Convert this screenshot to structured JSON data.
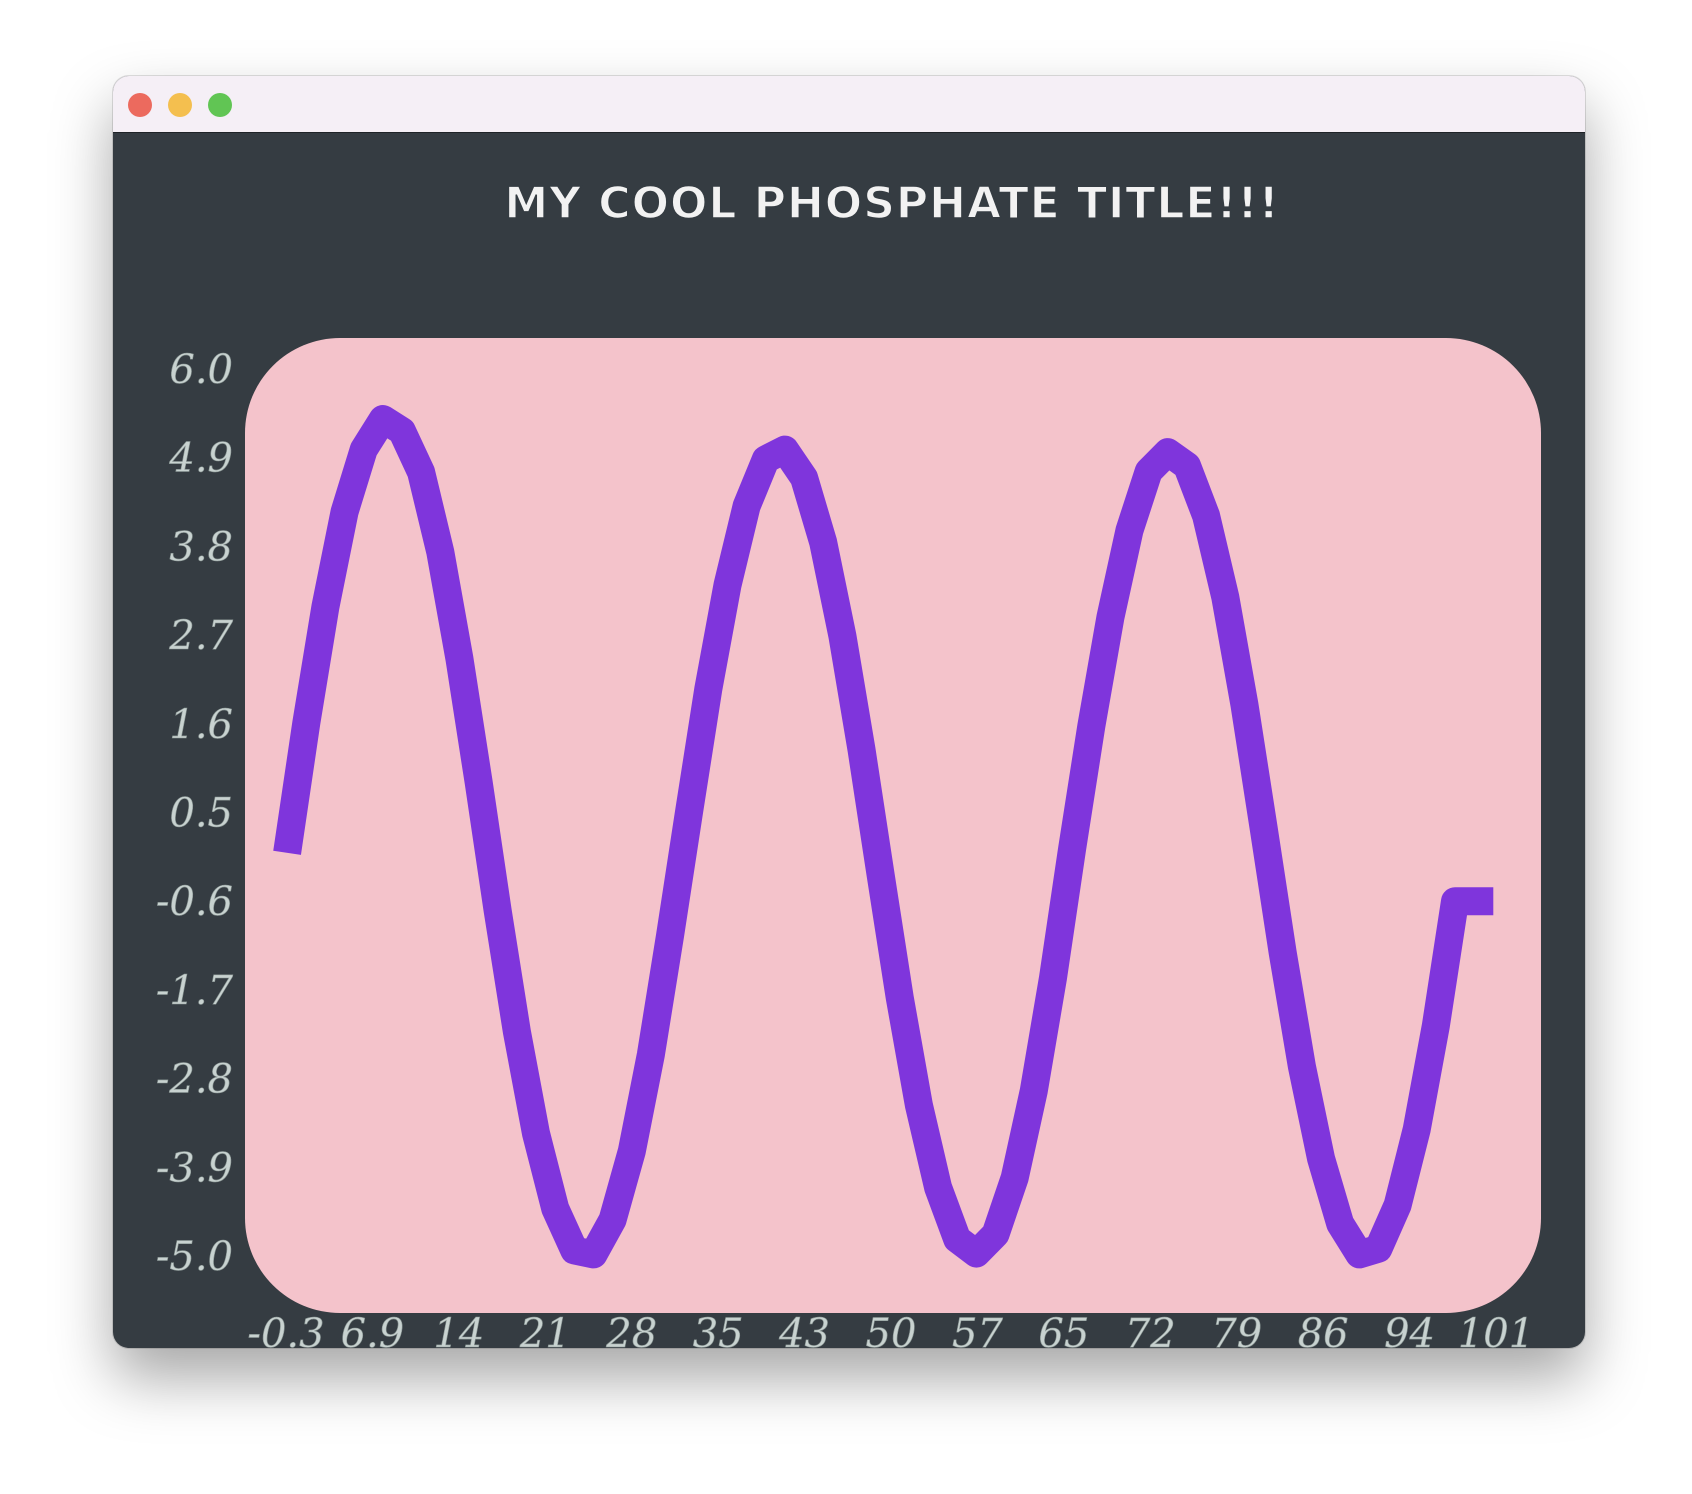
{
  "window": {
    "controls": [
      "close-button",
      "minimize-button",
      "zoom-button"
    ]
  },
  "colors": {
    "window_bg": "#353c42",
    "titlebar_bg": "#f5eff6",
    "plot_bg": "#f4c3cb",
    "line": "#7f35dc",
    "tick_text": "#c8d2d0",
    "title_text": "#f2f2f2"
  },
  "chart_data": {
    "type": "line",
    "title": "MY COOL PHOSPHATE TITLE!!!",
    "xlabel": "",
    "ylabel": "",
    "x_ticks": [
      "-0.3",
      "6.9",
      "14",
      "21",
      "28",
      "35",
      "43",
      "50",
      "57",
      "65",
      "72",
      "79",
      "86",
      "94",
      "101"
    ],
    "y_ticks": [
      "6.0",
      "4.9",
      "3.8",
      "2.7",
      "1.6",
      "0.5",
      "-0.6",
      "-1.7",
      "-2.8",
      "-3.9",
      "-5.0"
    ],
    "xlim": [
      -0.3,
      101
    ],
    "ylim": [
      -5.0,
      6.0
    ],
    "grid": false,
    "legend": "none",
    "series": [
      {
        "x": [
          3.0,
          4.5,
          6.0,
          7.5,
          9.0,
          10.5,
          12.0,
          13.5,
          15.0,
          16.5,
          18.0,
          19.5,
          21.0,
          22.5,
          24.0,
          25.5,
          27.0,
          28.5,
          30.0,
          31.5,
          33.0,
          34.5,
          36.0,
          37.5,
          39.0,
          40.5,
          42.0,
          43.5,
          45.0,
          46.5,
          48.0,
          49.5,
          51.0,
          52.5,
          54.0,
          55.5,
          57.0,
          58.5,
          60.0,
          61.5,
          63.0,
          64.5,
          66.0,
          67.5,
          69.0,
          70.5,
          72.0,
          73.5,
          75.0,
          76.5,
          78.0,
          79.5,
          81.0,
          82.5,
          84.0,
          85.5,
          87.0,
          88.5,
          90.0,
          91.5,
          93.0,
          94.5,
          96.0,
          97.5
        ],
        "values": [
          0.0,
          1.61,
          3.05,
          4.23,
          5.0,
          5.38,
          5.23,
          4.72,
          3.73,
          2.41,
          0.88,
          -0.72,
          -2.22,
          -3.48,
          -4.41,
          -4.93,
          -4.98,
          -4.55,
          -3.7,
          -2.5,
          -1.03,
          0.52,
          2.03,
          3.32,
          4.3,
          4.88,
          5.0,
          4.65,
          3.85,
          2.69,
          1.28,
          -0.28,
          -1.8,
          -3.13,
          -4.15,
          -4.79,
          -4.97,
          -4.73,
          -4.03,
          -2.95,
          -1.55,
          0.05,
          1.57,
          2.92,
          4.0,
          4.73,
          4.97,
          4.8,
          4.18,
          3.17,
          1.84,
          0.31,
          -1.24,
          -2.65,
          -3.79,
          -4.6,
          -4.98,
          -4.91,
          -4.37,
          -3.43,
          -2.14,
          -0.6,
          -0.6,
          -0.6
        ]
      }
    ]
  }
}
